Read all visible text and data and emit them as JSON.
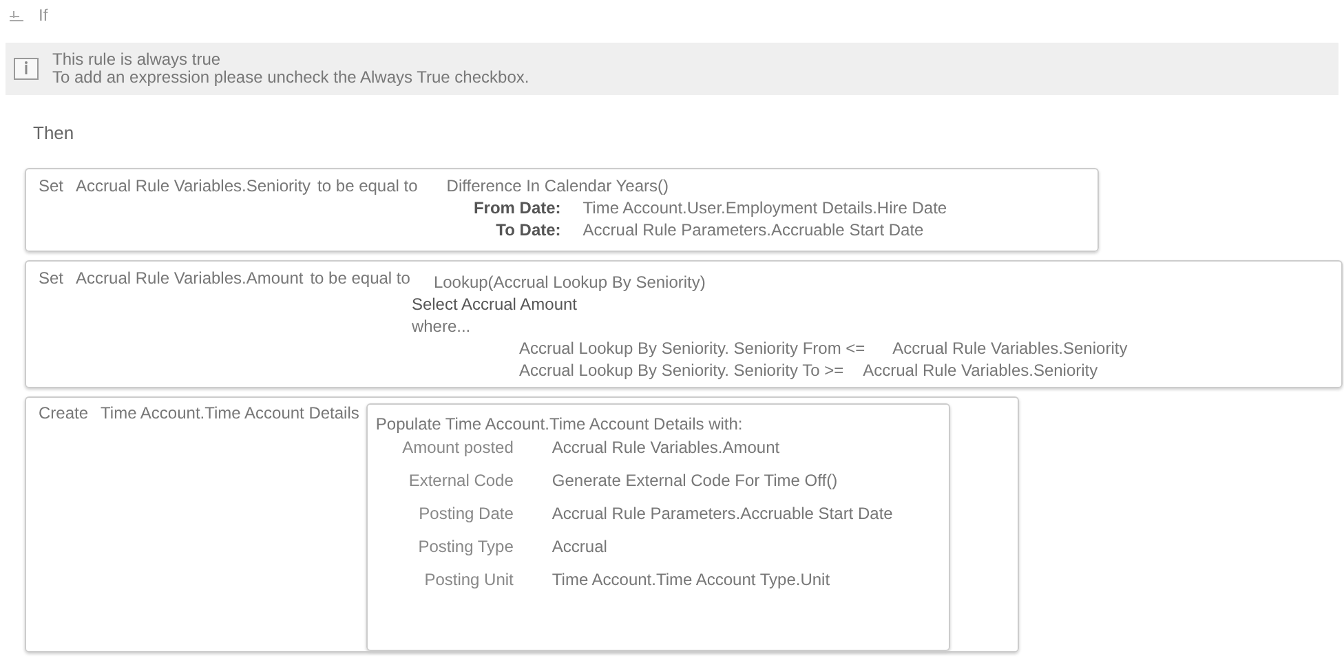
{
  "if_section": {
    "label": "If"
  },
  "info": {
    "title": "This rule is always true",
    "message": "To add an expression please uncheck the Always True checkbox."
  },
  "then_label": "Then",
  "actions": [
    {
      "kind": "set",
      "verb": "Set",
      "target": "Accrual Rule Variables.Seniority",
      "operator": "to be equal to",
      "function": "Difference In Calendar Years()",
      "params": [
        {
          "label": "From Date:",
          "value": "Time Account.User.Employment Details.Hire Date"
        },
        {
          "label": "To Date:",
          "value": "Accrual Rule Parameters.Accruable Start Date"
        }
      ]
    },
    {
      "kind": "lookup",
      "verb": "Set",
      "target": "Accrual Rule Variables.Amount",
      "operator": "to be equal to",
      "function": "Lookup(Accrual Lookup By Seniority)",
      "select": "Select Accrual Amount",
      "where": "where...",
      "conditions": [
        {
          "left": "Accrual Lookup By Seniority.  Seniority From <=",
          "right": "Accrual Rule Variables.Seniority"
        },
        {
          "left": "Accrual Lookup By Seniority.  Seniority To >=",
          "right": "Accrual Rule Variables.Seniority"
        }
      ]
    },
    {
      "kind": "create",
      "verb": "Create",
      "target": "Time Account.Time Account Details",
      "populate": {
        "title": "Populate Time Account.Time Account Details with:",
        "fields": [
          {
            "label": "Amount posted",
            "value": "Accrual Rule Variables.Amount"
          },
          {
            "label": "External Code",
            "value": "Generate External Code For Time Off()"
          },
          {
            "label": "Posting Date",
            "value": "Accrual Rule Parameters.Accruable Start Date"
          },
          {
            "label": "Posting Type",
            "value": "Accrual"
          },
          {
            "label": "Posting Unit",
            "value": "Time Account.Time Account Type.Unit"
          }
        ]
      }
    }
  ]
}
